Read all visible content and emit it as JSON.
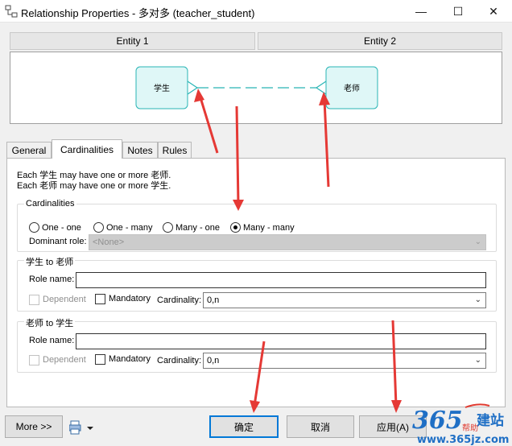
{
  "window": {
    "title": "Relationship Properties - 多对多 (teacher_student)",
    "controls": {
      "minimize": "—",
      "maximize": "☐",
      "close": "✕"
    }
  },
  "entities": {
    "entity1_header": "Entity 1",
    "entity2_header": "Entity 2",
    "entity1_name": "学生",
    "entity2_name": "老师"
  },
  "tabs": [
    {
      "label": "General",
      "active": false
    },
    {
      "label": "Cardinalities",
      "active": true
    },
    {
      "label": "Notes",
      "active": false
    },
    {
      "label": "Rules",
      "active": false
    }
  ],
  "description": {
    "line1": "Each 学生 may have one or more 老师.",
    "line2": "Each 老师 may have one or more 学生."
  },
  "cardinalities": {
    "legend": "Cardinalities",
    "options": [
      {
        "label": "One - one",
        "selected": false
      },
      {
        "label": "One - many",
        "selected": false
      },
      {
        "label": "Many - one",
        "selected": false
      },
      {
        "label": "Many - many",
        "selected": true
      }
    ],
    "dominant_label": "Dominant role:",
    "dominant_value": "<None>"
  },
  "role1": {
    "legend": "学生 to 老师",
    "role_name_label": "Role name:",
    "role_name_value": "",
    "dependent_label": "Dependent",
    "dependent_checked": false,
    "mandatory_label": "Mandatory",
    "mandatory_checked": false,
    "cardinality_label": "Cardinality:",
    "cardinality_value": "0,n"
  },
  "role2": {
    "legend": "老师 to 学生",
    "role_name_label": "Role name:",
    "role_name_value": "",
    "dependent_label": "Dependent",
    "dependent_checked": false,
    "mandatory_label": "Mandatory",
    "mandatory_checked": false,
    "cardinality_label": "Cardinality:",
    "cardinality_value": "0,n"
  },
  "footer": {
    "more_label": "More >>",
    "ok_label": "确定",
    "cancel_label": "取消",
    "apply_label": "应用(A)"
  },
  "watermark": {
    "brand": "建站",
    "number": "365",
    "help": "帮助",
    "url": "www.365jz.com"
  },
  "colors": {
    "entity_fill": "#dff7f7",
    "entity_border": "#29b5b5",
    "annotation_arrow": "#e53935",
    "focus_border": "#0078d7",
    "watermark_blue": "#1f6fc5",
    "watermark_red": "#e03a2f"
  },
  "icons": {
    "app": "relationship-icon",
    "print": "print-icon"
  }
}
